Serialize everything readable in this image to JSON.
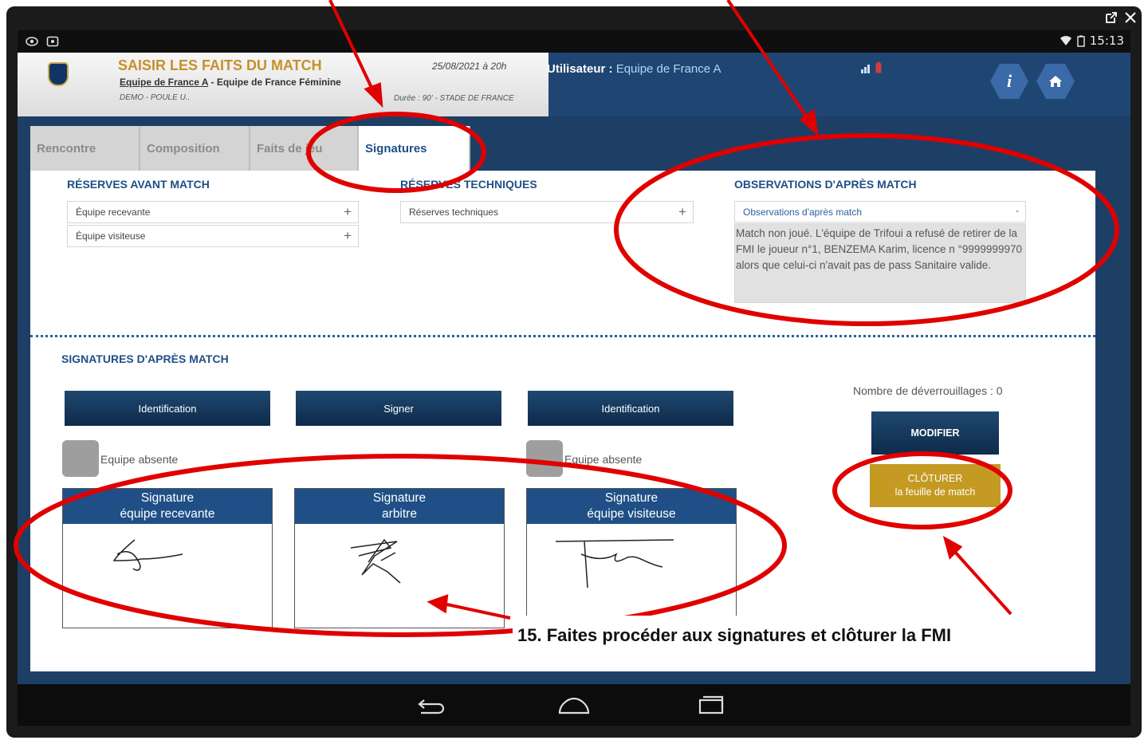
{
  "statusbar": {
    "time": "15:13"
  },
  "header": {
    "app_title": "SAISIR LES FAITS DU MATCH",
    "home_team": "Equipe de France A",
    "separator": " - ",
    "away_team": "Equipe de France Féminine",
    "competition": "DEMO - POULE U..",
    "date": "25/08/2021 à 20h",
    "duration": "Durée : 90' - STADE DE FRANCE",
    "user_label": "Utilisateur :",
    "user_value": "Equipe de France A",
    "info_icon": "i"
  },
  "tabs": [
    "Rencontre",
    "Composition",
    "Faits de jeu",
    "Signatures"
  ],
  "sections": {
    "reserves_avant": "RÉSERVES AVANT MATCH",
    "reserves_tech": "RÉSERVES TECHNIQUES",
    "observations": "OBSERVATIONS D'APRÈS MATCH",
    "signatures": "SIGNATURES D'APRÈS MATCH"
  },
  "fields": {
    "equipe_recevante": "Équipe recevante",
    "equipe_visiteuse": "Équipe visiteuse",
    "reserves_techniques": "Réserves techniques",
    "observations_head": "Observations d'après match",
    "observations_text": "Match non joué. L'équipe de Trifoui a refusé de retirer de la FMI le joueur n°1, BENZEMA Karim, licence n °9999999970 alors que celui-ci n'avait pas de pass Sanitaire valide.",
    "plus": "+",
    "minus": "-"
  },
  "signature_panel": {
    "btn_identification_1": "Identification",
    "btn_signer": "Signer",
    "btn_identification_2": "Identification",
    "equipe_absente": "Equipe absente",
    "sig_home": [
      "Signature",
      "équipe recevante"
    ],
    "sig_referee": [
      "Signature",
      "arbitre"
    ],
    "sig_away": [
      "Signature",
      "équipe visiteuse"
    ],
    "unlock_count": "Nombre de déverrouillages : 0",
    "btn_modifier": "MODIFIER",
    "btn_cloturer_1": "CLÔTURER",
    "btn_cloturer_2": "la feuille de match"
  },
  "annotation": {
    "callout": "15. Faites procéder aux signatures et clôturer la FMI"
  },
  "colors": {
    "brand_blue": "#1f4f86",
    "gold": "#c49a22",
    "annotation_red": "#e00000"
  }
}
